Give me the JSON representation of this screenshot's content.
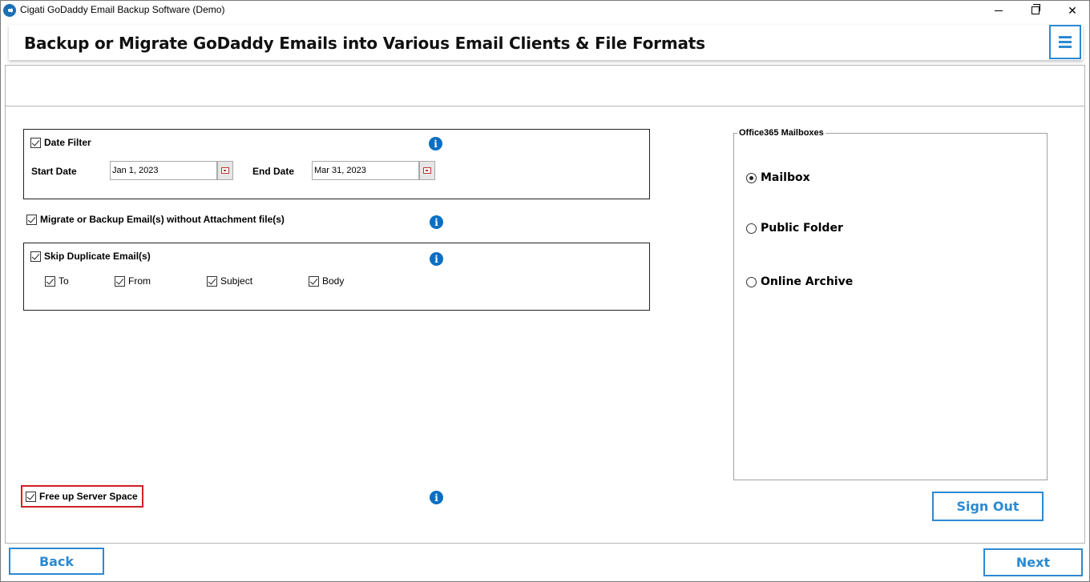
{
  "window": {
    "title": "Cigati GoDaddy Email Backup Software (Demo)"
  },
  "header": {
    "title": "Backup or Migrate GoDaddy Emails into Various Email Clients & File Formats"
  },
  "options": {
    "date_filter": {
      "label": "Date Filter",
      "checked": true
    },
    "start_date_label": "Start Date",
    "start_date_value": "Jan 1, 2023",
    "end_date_label": "End Date",
    "end_date_value": "Mar 31, 2023",
    "without_attachment": {
      "label": "Migrate or Backup Email(s) without Attachment file(s)",
      "checked": true
    },
    "skip_duplicate": {
      "label": "Skip Duplicate Email(s)",
      "checked": true
    },
    "dup_fields": [
      {
        "label": "To",
        "checked": true
      },
      {
        "label": "From",
        "checked": true
      },
      {
        "label": "Subject",
        "checked": true
      },
      {
        "label": "Body",
        "checked": true
      }
    ],
    "free_up": {
      "label": "Free up Server Space",
      "checked": true
    }
  },
  "mailboxes": {
    "legend": "Office365 Mailboxes",
    "items": [
      {
        "label": "Mailbox",
        "selected": true
      },
      {
        "label": "Public Folder",
        "selected": false
      },
      {
        "label": "Online Archive",
        "selected": false
      }
    ]
  },
  "buttons": {
    "sign_out": "Sign Out",
    "back": "Back",
    "next": "Next"
  },
  "colors": {
    "accent": "#2a8ad3",
    "info": "#0a6fc2",
    "highlight": "#d21f26"
  }
}
